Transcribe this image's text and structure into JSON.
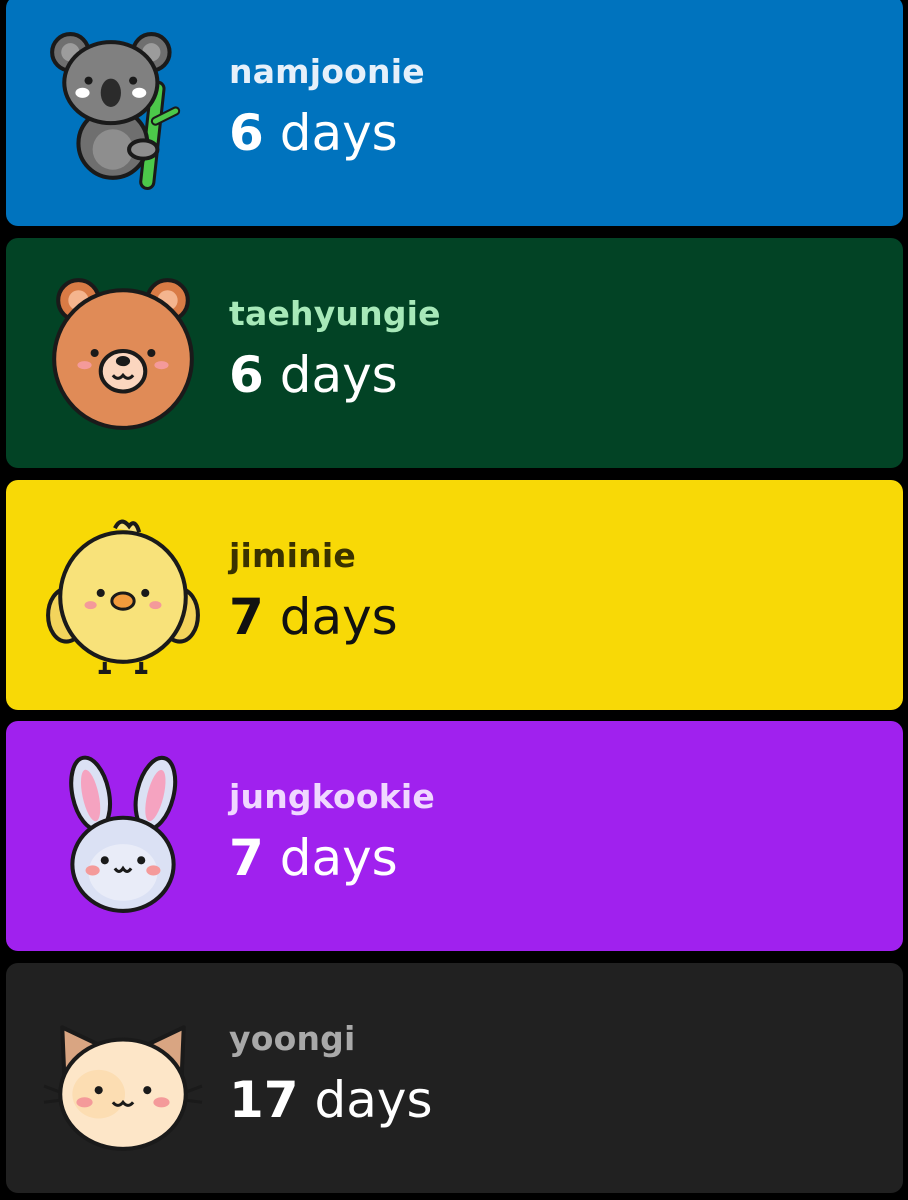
{
  "cards": [
    {
      "name": "namjoonie",
      "count": "6",
      "unit": "days",
      "icon": "koala-icon",
      "bg_color": "#0073BE",
      "name_color": "#E6F0FA",
      "count_color": "#FFFFFF"
    },
    {
      "name": "taehyungie",
      "count": "6",
      "unit": "days",
      "icon": "bear-icon",
      "bg_color": "#024325",
      "name_color": "#A7E9B9",
      "count_color": "#FFFFFF"
    },
    {
      "name": "jiminie",
      "count": "7",
      "unit": "days",
      "icon": "chick-icon",
      "bg_color": "#F8D906",
      "name_color": "#3A3200",
      "count_color": "#111111"
    },
    {
      "name": "jungkookie",
      "count": "7",
      "unit": "days",
      "icon": "bunny-icon",
      "bg_color": "#A021EE",
      "name_color": "#F0D8FF",
      "count_color": "#FFFFFF"
    },
    {
      "name": "yoongi",
      "count": "17",
      "unit": "days",
      "icon": "cat-icon",
      "bg_color": "#212121",
      "name_color": "#A9A9A9",
      "count_color": "#FFFFFF"
    }
  ]
}
